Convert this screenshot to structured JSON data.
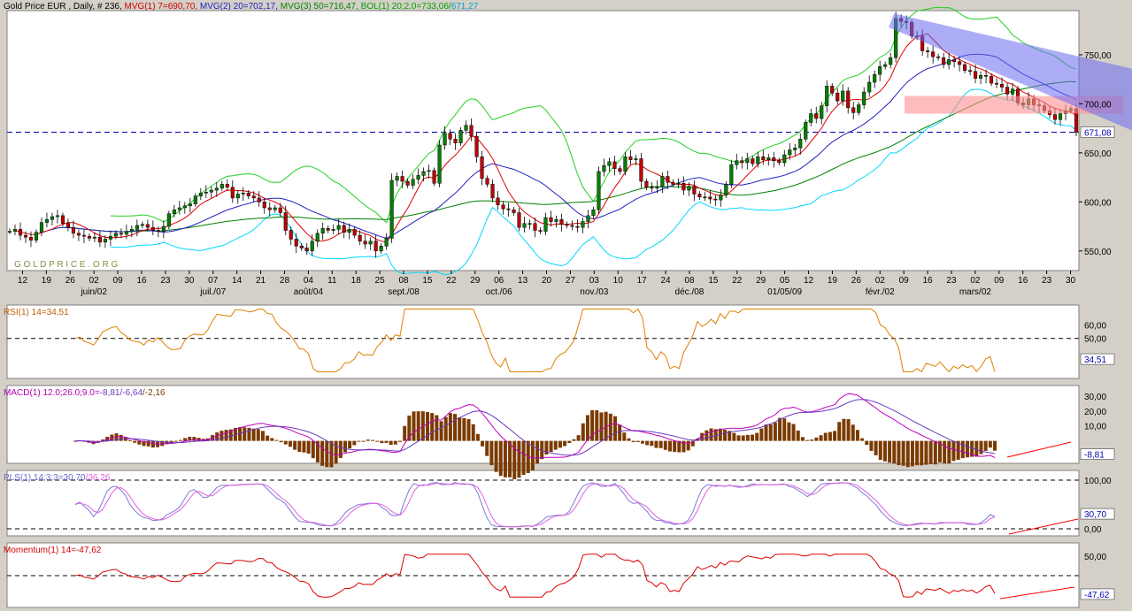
{
  "header": {
    "instrument": "Gold Price EUR , Daily, # 236,",
    "mvg1": "MVG(1) 7=690,70,",
    "mvg2": "MVG(2) 20=702,17,",
    "mvg3": "MVG(3) 50=716,47,",
    "bol_a": "BOL(1) 20;2.0=733,06/",
    "bol_b": "671,27"
  },
  "watermark": "G O L D P R I C E . O R G",
  "colors": {
    "bg": "#ffffff",
    "frame": "#d4d0c8",
    "mvg1": "#e00000",
    "mvg2": "#2020c0",
    "mvg3": "#008000",
    "bol_upper": "#20d020",
    "bol_lower": "#00d8ff",
    "candle_up": "#008000",
    "candle_down": "#c00000",
    "channel": "#6a6af0",
    "resistance": "#ff9090",
    "support_line": "#0000b0",
    "rsi": "#e08000",
    "macd_line": "#c000c0",
    "macd_signal": "#6a3ac0",
    "macd_hist": "#7a3a00",
    "stoch_k": "#7a7ad8",
    "stoch_d": "#e060e0",
    "momentum": "#e00000",
    "trend": "#ff0000"
  },
  "price_axis": {
    "labels": [
      "750,00",
      "700,00",
      "650,00",
      "600,00",
      "550,00"
    ],
    "current": "671,08"
  },
  "x_axis": {
    "days": [
      "12",
      "19",
      "26",
      "02",
      "09",
      "16",
      "23",
      "30",
      "07",
      "14",
      "21",
      "28",
      "04",
      "11",
      "18",
      "25",
      "08",
      "15",
      "22",
      "29",
      "06",
      "13",
      "20",
      "27",
      "03",
      "10",
      "17",
      "24",
      "08",
      "15",
      "22",
      "29",
      "05",
      "12",
      "19",
      "26",
      "02",
      "09",
      "16",
      "23",
      "02",
      "09",
      "16",
      "23",
      "30"
    ],
    "months": [
      "juin/02",
      "juil./07",
      "août/04",
      "sept./08",
      "oct./06",
      "nov./03",
      "déc./08",
      "01/05/09",
      "févr./02",
      "mars/02"
    ]
  },
  "panels": {
    "rsi": {
      "title": "RSI(1) 14=34,51",
      "labels": [
        "60,00",
        "50,00"
      ],
      "current": "34,51"
    },
    "macd": {
      "title_a": "MACD(1) 12.0;26.0;9.0=",
      "title_b": "-8,81",
      "title_c": "/-6,64",
      "title_d": "/-2,16",
      "labels": [
        "30,00",
        "20,00",
        "10,00"
      ],
      "current": "-8,81"
    },
    "stoch": {
      "title_a": "PLS(1) 14;3;3=30,70",
      "title_b": "/36,26",
      "labels": [
        "100,00",
        "0,00"
      ],
      "current": "30,70"
    },
    "momentum": {
      "title": "Momentum(1) 14=-47,62",
      "labels": [
        "50,00"
      ],
      "current": "-47,62"
    }
  },
  "chart_data": {
    "type": "candlestick",
    "title": "Gold Price EUR , Daily",
    "price_range": [
      530,
      795
    ],
    "close": [
      570,
      572,
      566,
      564,
      561,
      569,
      579,
      582,
      585,
      586,
      578,
      574,
      568,
      566,
      565,
      563,
      564,
      559,
      562,
      565,
      568,
      567,
      570,
      572,
      576,
      577,
      574,
      571,
      570,
      575,
      588,
      592,
      594,
      596,
      598,
      606,
      609,
      610,
      612,
      614,
      618,
      615,
      604,
      608,
      609,
      606,
      604,
      600,
      594,
      592,
      594,
      589,
      571,
      562,
      555,
      553,
      550,
      560,
      568,
      573,
      571,
      572,
      576,
      569,
      572,
      566,
      560,
      557,
      560,
      550,
      555,
      563,
      622,
      626,
      621,
      617,
      623,
      627,
      631,
      632,
      619,
      658,
      670,
      664,
      660,
      673,
      678,
      667,
      646,
      624,
      618,
      604,
      597,
      593,
      592,
      589,
      574,
      578,
      578,
      571,
      570,
      584,
      580,
      582,
      577,
      576,
      575,
      574,
      580,
      586,
      592,
      631,
      637,
      641,
      634,
      631,
      646,
      643,
      644,
      621,
      615,
      614,
      615,
      626,
      620,
      618,
      619,
      612,
      616,
      608,
      605,
      605,
      603,
      602,
      607,
      618,
      638,
      642,
      640,
      644,
      639,
      646,
      643,
      645,
      642,
      640,
      648,
      653,
      655,
      664,
      681,
      690,
      685,
      698,
      718,
      711,
      703,
      713,
      696,
      691,
      699,
      712,
      722,
      730,
      738,
      740,
      747,
      787,
      784,
      783,
      769,
      769,
      754,
      753,
      748,
      747,
      740,
      745,
      743,
      740,
      734,
      733,
      726,
      729,
      728,
      721,
      720,
      717,
      710,
      715,
      701,
      699,
      705,
      699,
      698,
      693,
      689,
      684,
      690,
      693,
      695,
      671
    ],
    "mvg": [
      {
        "name": "MVG(1) 7",
        "last": 690.7
      },
      {
        "name": "MVG(2) 20",
        "last": 702.17
      },
      {
        "name": "MVG(3) 50",
        "last": 716.47
      }
    ],
    "bollinger": {
      "upper_last": 733.06,
      "lower_last": 671.27
    },
    "resistance_zone": [
      690,
      708
    ],
    "support_level": 671.08,
    "channel": {
      "top": [
        [
          169,
          792
        ],
        [
          236,
          695
        ]
      ],
      "bottom": [
        [
          169,
          778
        ],
        [
          236,
          606
        ]
      ]
    },
    "indicators": {
      "rsi": 34.51,
      "macd": -8.81,
      "signal": -6.64,
      "hist": -2.16,
      "stoch_k": 30.7,
      "stoch_d": 36.26,
      "momentum": -47.62
    }
  }
}
